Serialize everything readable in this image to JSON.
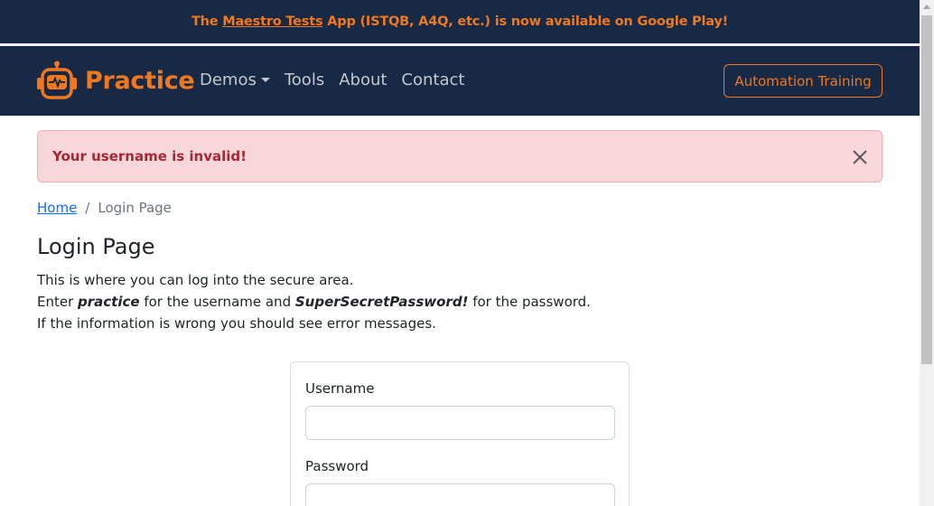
{
  "promo": {
    "prefix": "The ",
    "link": "Maestro Tests",
    "suffix": " App (ISTQB, A4Q, etc.) is now available on Google Play!"
  },
  "navbar": {
    "brand": "Practice",
    "links": [
      "Demos",
      "Tools",
      "About",
      "Contact"
    ],
    "cta": "Automation Training"
  },
  "alert": {
    "message": "Your username is invalid!"
  },
  "breadcrumb": {
    "home": "Home",
    "separator": "/",
    "current": "Login Page"
  },
  "page": {
    "title": "Login Page",
    "line1": "This is where you can log into the secure area.",
    "line2_pre": "Enter ",
    "line2_user": "practice",
    "line2_mid": " for the username and ",
    "line2_pass": "SuperSecretPassword!",
    "line2_post": " for the password.",
    "line3": "If the information is wrong you should see error messages."
  },
  "form": {
    "username_label": "Username",
    "username_value": "",
    "password_label": "Password",
    "password_value": ""
  },
  "colors": {
    "nav_bg": "#172945",
    "brand_orange": "#f0781f",
    "alert_bg": "#f8d7da",
    "alert_text": "#a52834",
    "link_blue": "#0d6efd"
  }
}
